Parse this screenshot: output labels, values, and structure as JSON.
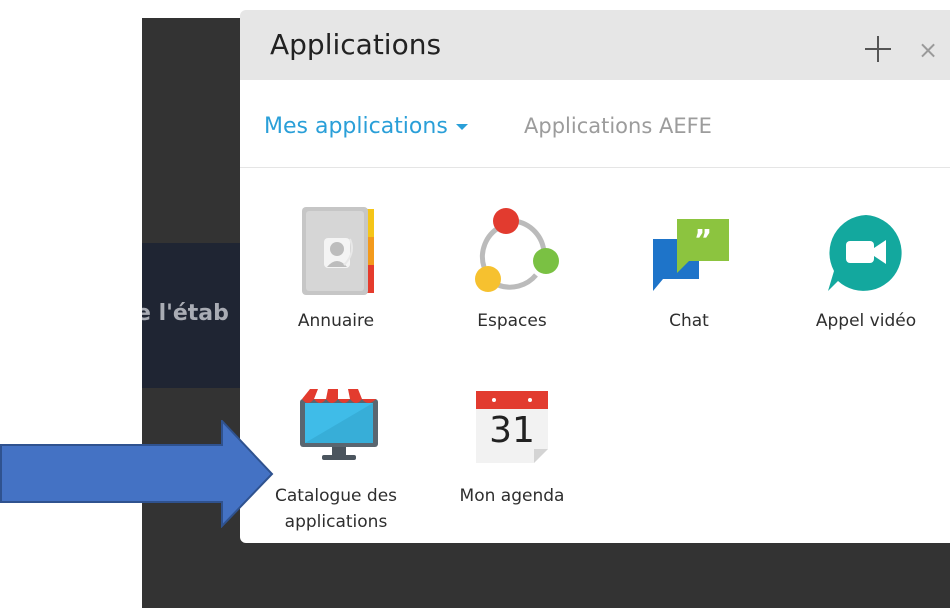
{
  "background": {
    "partial_text": "e l'étab"
  },
  "panel": {
    "title": "Applications",
    "add_icon": "plus-icon",
    "close_glyph": "×"
  },
  "tabs": {
    "active": "Mes applications",
    "other": "Applications AEFE"
  },
  "apps": [
    {
      "label": "Annuaire",
      "icon": "address-book-icon"
    },
    {
      "label": "Espaces",
      "icon": "spaces-icon"
    },
    {
      "label": "Chat",
      "icon": "chat-bubbles-icon"
    },
    {
      "label": "Appel vidéo",
      "icon": "video-call-icon"
    },
    {
      "label_line1": "Catalogue des",
      "label_line2": "applications",
      "icon": "store-monitor-icon"
    },
    {
      "label": "Mon agenda",
      "icon": "calendar-icon",
      "calendar_day": "31"
    }
  ],
  "annotation": {
    "icon": "arrow-right-icon",
    "color": "#4472c4"
  },
  "colors": {
    "accent": "#2a9fd8",
    "header_bg": "#e6e6e6",
    "page_bg": "#333333"
  }
}
